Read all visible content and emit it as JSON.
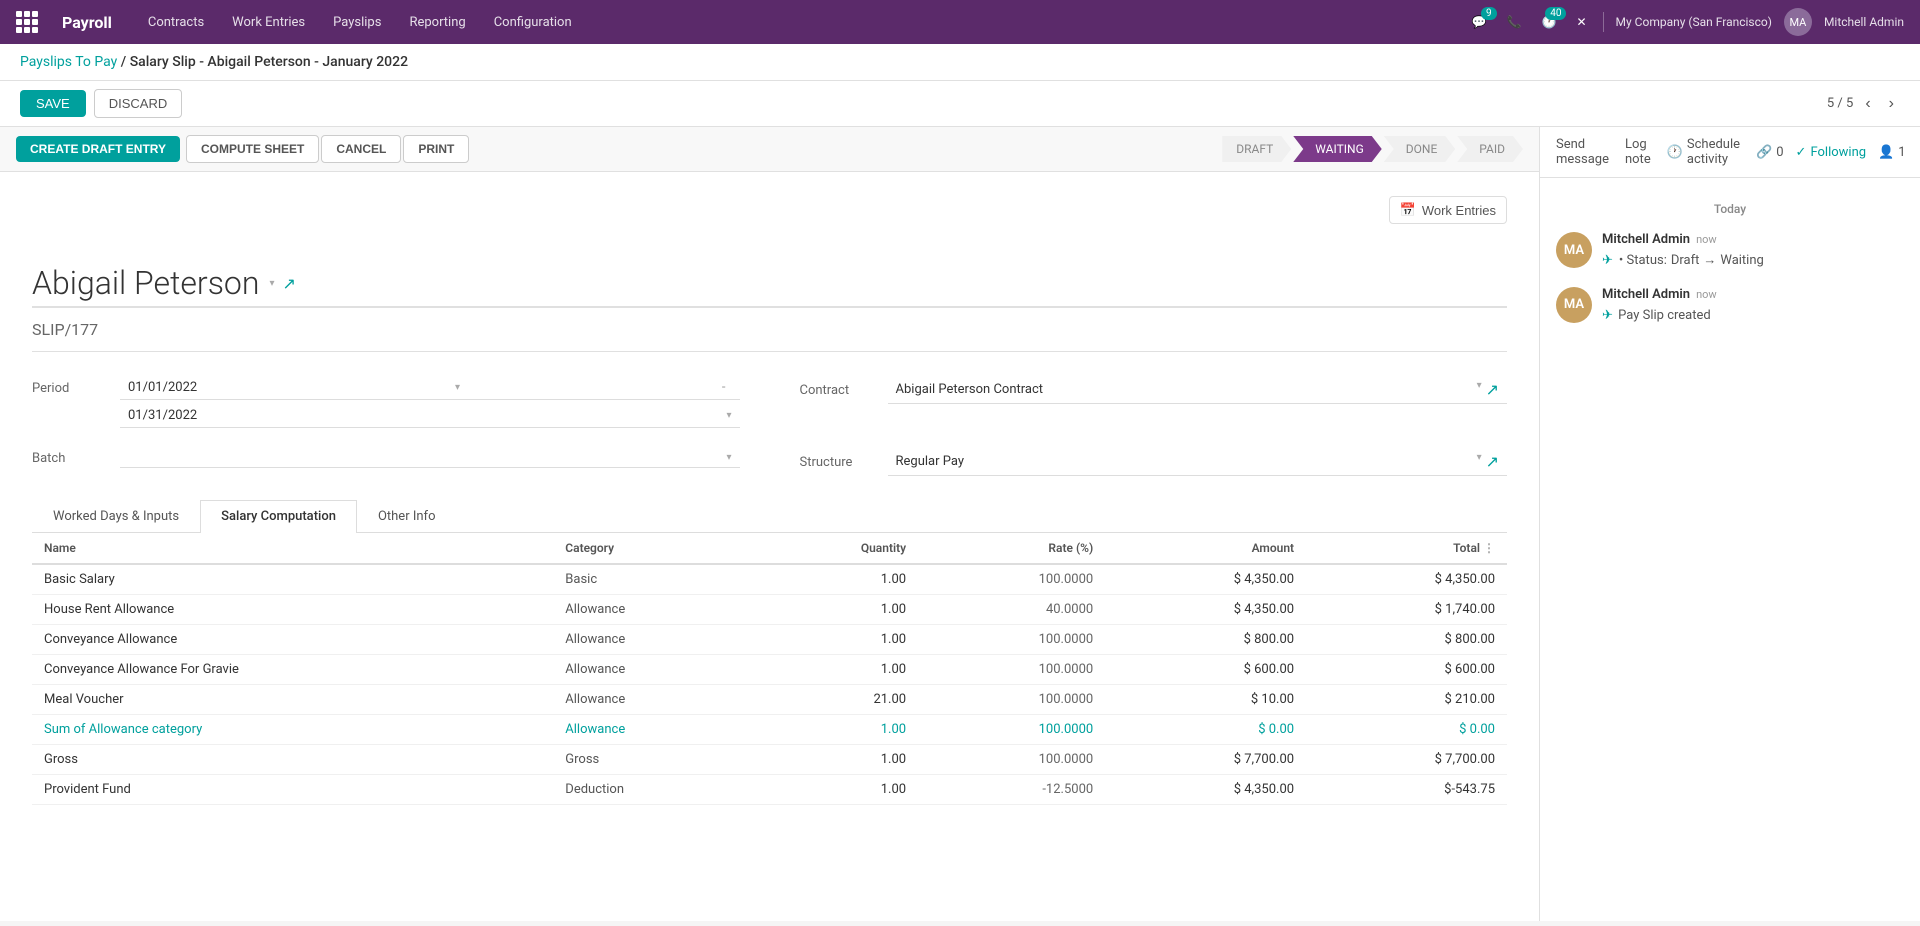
{
  "topnav": {
    "brand": "Payroll",
    "menu": [
      "Contracts",
      "Work Entries",
      "Payslips",
      "Reporting",
      "Configuration"
    ],
    "notifications": {
      "chat": "9",
      "clock": "40"
    },
    "company": "My Company (San Francisco)",
    "user": "Mitchell Admin"
  },
  "breadcrumb": {
    "parent": "Payslips To Pay",
    "separator": "/",
    "current": "Salary Slip - Abigail Peterson - January 2022"
  },
  "actionbar": {
    "save": "SAVE",
    "discard": "DISCARD",
    "pagination": "5 / 5"
  },
  "doctoolbar": {
    "create_draft": "CREATE DRAFT ENTRY",
    "compute_sheet": "COMPUTE SHEET",
    "cancel": "CANCEL",
    "print": "PRINT"
  },
  "status_steps": [
    "DRAFT",
    "WAITING",
    "DONE",
    "PAID"
  ],
  "active_step": "WAITING",
  "form": {
    "employee_name": "Abigail Peterson",
    "slip_number": "SLIP/177",
    "period_start": "01/01/2022",
    "period_end": "01/31/2022",
    "batch": "",
    "contract": "Abigail Peterson Contract",
    "structure": "Regular Pay",
    "work_entries_btn": "Work Entries"
  },
  "tabs": [
    {
      "id": "worked",
      "label": "Worked Days & Inputs"
    },
    {
      "id": "salary",
      "label": "Salary Computation",
      "active": true
    },
    {
      "id": "other",
      "label": "Other Info"
    }
  ],
  "table": {
    "headers": [
      "Name",
      "Category",
      "Quantity",
      "Rate (%)",
      "Amount",
      "Total"
    ],
    "rows": [
      {
        "name": "Basic Salary",
        "name_link": false,
        "category": "Basic",
        "category_link": false,
        "quantity": "1.00",
        "rate": "100.0000",
        "amount": "$ 4,350.00",
        "total": "$ 4,350.00"
      },
      {
        "name": "House Rent Allowance",
        "name_link": false,
        "category": "Allowance",
        "category_link": false,
        "quantity": "1.00",
        "rate": "40.0000",
        "amount": "$ 4,350.00",
        "total": "$ 1,740.00"
      },
      {
        "name": "Conveyance Allowance",
        "name_link": false,
        "category": "Allowance",
        "category_link": false,
        "quantity": "1.00",
        "rate": "100.0000",
        "amount": "$ 800.00",
        "total": "$ 800.00"
      },
      {
        "name": "Conveyance Allowance For Gravie",
        "name_link": false,
        "category": "Allowance",
        "category_link": false,
        "quantity": "1.00",
        "rate": "100.0000",
        "amount": "$ 600.00",
        "total": "$ 600.00"
      },
      {
        "name": "Meal Voucher",
        "name_link": false,
        "category": "Allowance",
        "category_link": false,
        "quantity": "21.00",
        "rate": "100.0000",
        "amount": "$ 10.00",
        "total": "$ 210.00"
      },
      {
        "name": "Sum of Allowance category",
        "name_link": true,
        "category": "Allowance",
        "category_link": true,
        "quantity": "1.00",
        "rate": "100.0000",
        "amount": "$ 0.00",
        "total": "$ 0.00"
      },
      {
        "name": "Gross",
        "name_link": false,
        "category": "Gross",
        "category_link": false,
        "quantity": "1.00",
        "rate": "100.0000",
        "amount": "$ 7,700.00",
        "total": "$ 7,700.00"
      },
      {
        "name": "Provident Fund",
        "name_link": false,
        "category": "Deduction",
        "category_link": false,
        "quantity": "1.00",
        "rate": "-12.5000",
        "amount": "$ 4,350.00",
        "total": "$-543.75"
      }
    ]
  },
  "chatter": {
    "actions": {
      "send_message": "Send message",
      "log_note": "Log note",
      "schedule_activity": "Schedule activity"
    },
    "counts": {
      "paperclip": "0",
      "following": "Following",
      "followers": "1"
    },
    "date_divider": "Today",
    "messages": [
      {
        "author": "Mitchell Admin",
        "time": "now",
        "body_type": "status_change",
        "status_from": "Draft",
        "status_to": "Waiting"
      },
      {
        "author": "Mitchell Admin",
        "time": "now",
        "body_type": "text",
        "body": "Pay Slip created"
      }
    ]
  }
}
